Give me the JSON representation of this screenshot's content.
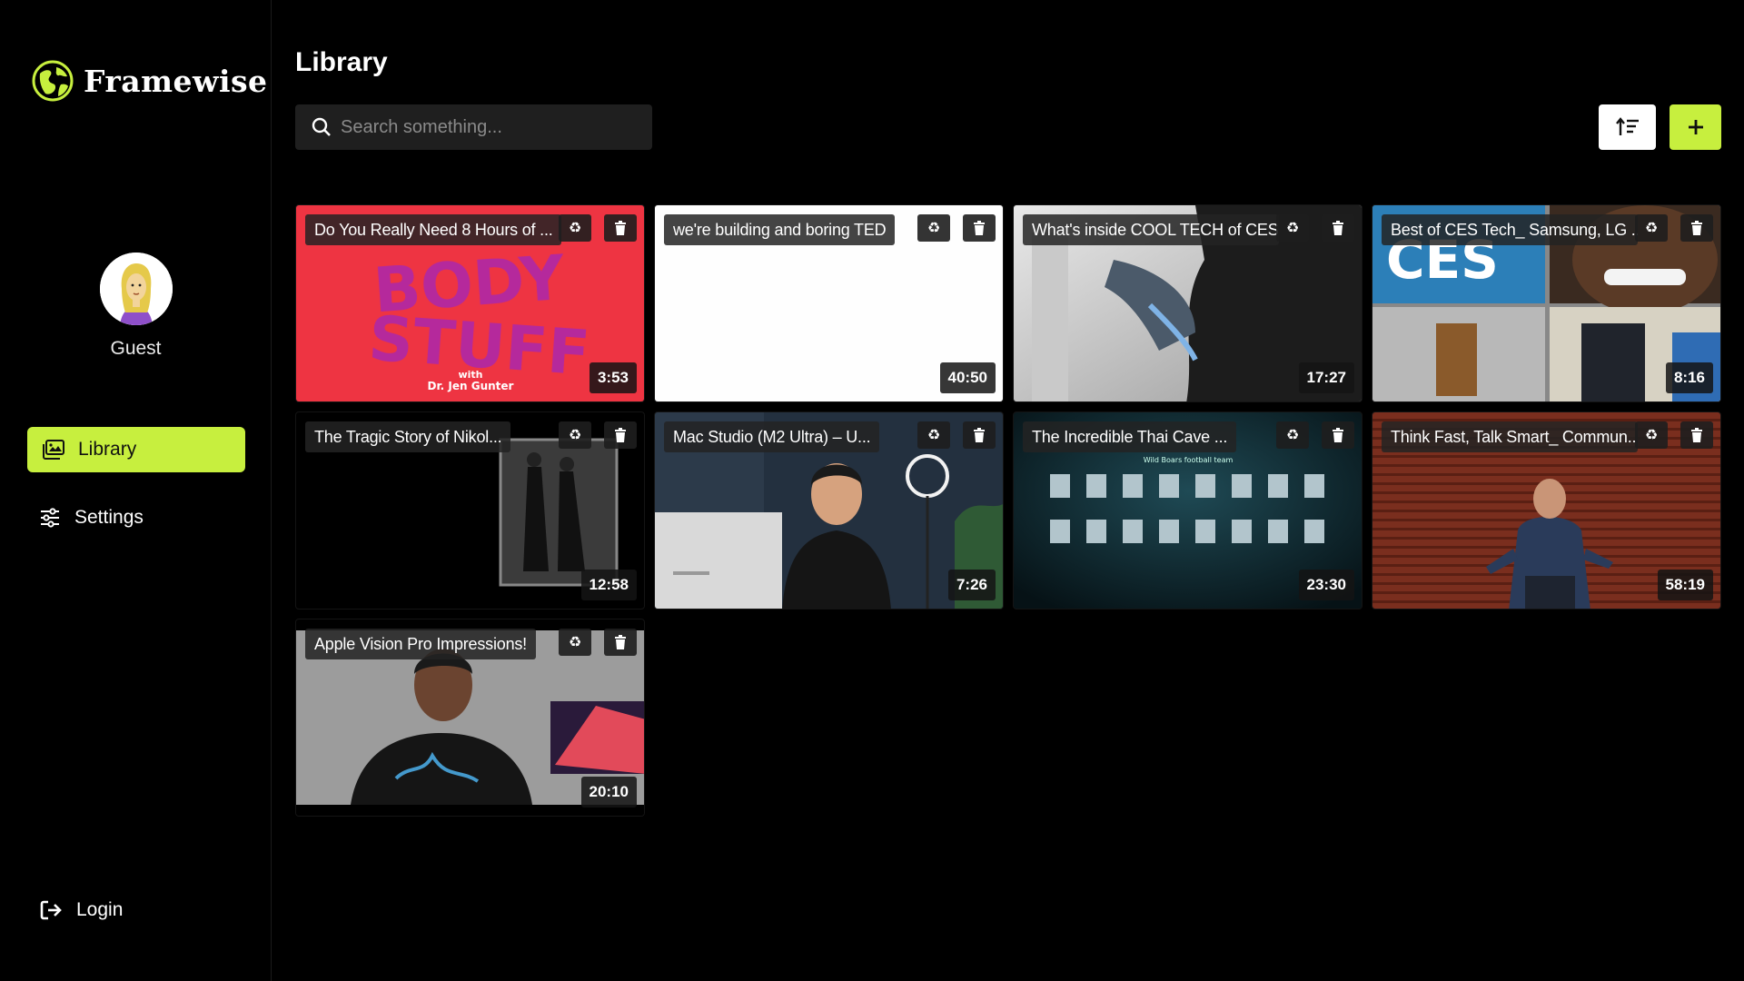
{
  "app": {
    "name": "Framewise",
    "accent": "#c7ef3e"
  },
  "profile": {
    "name": "Guest"
  },
  "nav": [
    {
      "label": "Library",
      "icon": "library-icon",
      "active": true
    },
    {
      "label": "Settings",
      "icon": "sliders-icon",
      "active": false
    }
  ],
  "footer": {
    "login_label": "Login"
  },
  "main": {
    "title": "Library",
    "search_placeholder": "Search something..."
  },
  "videos": [
    {
      "title": "Do You Really Need 8 Hours of ...",
      "duration": "3:53"
    },
    {
      "title": "we're building and boring TED",
      "duration": "40:50"
    },
    {
      "title": "What's inside COOL TECH of CES.",
      "duration": "17:27"
    },
    {
      "title": "Best of CES Tech_ Samsung, LG ...",
      "duration": "8:16"
    },
    {
      "title": "The Tragic Story of Nikol...",
      "duration": "12:58"
    },
    {
      "title": "Mac Studio (M2 Ultra) – U...",
      "duration": "7:26"
    },
    {
      "title": "The Incredible Thai Cave ...",
      "duration": "23:30"
    },
    {
      "title": "Think Fast, Talk Smart_ Commun...",
      "duration": "58:19"
    },
    {
      "title": "Apple Vision Pro Impressions!",
      "duration": "20:10"
    }
  ],
  "thumb_text": {
    "body_stuff_1": "BODY",
    "body_stuff_2": "STUFF",
    "body_stuff_3": "with",
    "body_stuff_4": "Dr. Jen Gunter",
    "ces": "CES",
    "cave_caption": "Wild Boars football team"
  }
}
